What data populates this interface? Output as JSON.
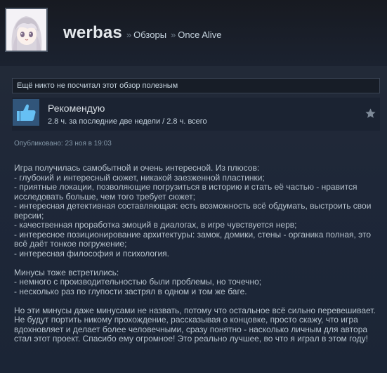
{
  "header": {
    "username": "werbas",
    "separator": "»",
    "breadcrumb_reviews": "Обзоры",
    "breadcrumb_game": "Once Alive"
  },
  "helpful_notice": "Ещё никто не посчитал этот обзор полезным",
  "recommendation": {
    "title": "Рекомендую",
    "hours": "2.8 ч. за последние две недели / 2.8 ч. всего",
    "icon": "thumbs-up-icon"
  },
  "published": {
    "label": "Опубликовано:",
    "date": "23 ноя в 19:03"
  },
  "review": {
    "p1": [
      "Игра получилась самобытной и очень интересной. Из плюсов:",
      "- глубокий и интересный сюжет, никакой заезженной пластинки;",
      "- приятные локации, позволяющие погрузиться в историю и стать её частью - нравится исследовать больше, чем того требует сюжет;",
      "- интересная детективная составляющая: есть возможность всё обдумать, выстроить свои версии;",
      "- качественная проработка эмоций в диалогах, в игре чувствуется нерв;",
      "- интересное позиционирование архитектуры: замок, домики, стены - органика полная, это всё даёт тонкое погружение;",
      "- интересная философия и психология."
    ],
    "p2": [
      "Минусы тоже встретились:",
      "- немного с производительностью были проблемы, но точечно;",
      "- несколько раз по глупости застрял в одном и том же баге."
    ],
    "p3": "Но эти минусы даже минусами не назвать, потому что остальное всё сильно перевешивает. Не будут портить никому прохождение, рассказывая о концовке, просто скажу, что игра вдохновляет и делает более человечными, сразу понятно - насколько личным для автора стал этот проект. Спасибо ему огромное! Это реально лучшее, во что я играл в этом году!"
  },
  "colors": {
    "background": "#1b2838",
    "link": "#c6d4df",
    "thumb_bg": "#31557a",
    "thumb_fg": "#66c0f4"
  }
}
